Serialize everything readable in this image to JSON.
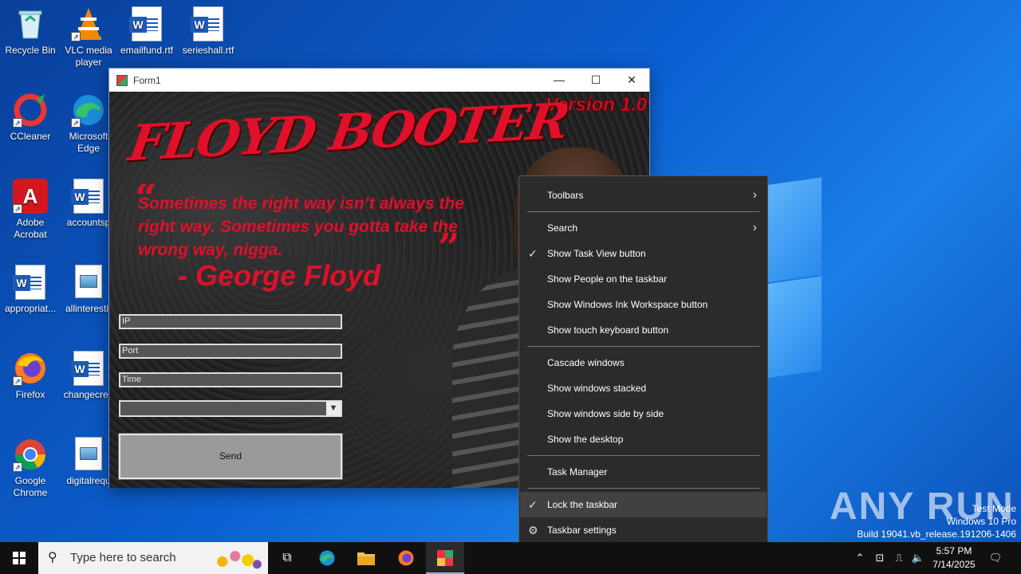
{
  "desktop": {
    "icons": [
      {
        "label": "Recycle Bin",
        "icon": "recycle-bin-icon"
      },
      {
        "label": "VLC media player",
        "icon": "vlc-icon"
      },
      {
        "label": "emailfund.rtf",
        "icon": "word-doc-icon"
      },
      {
        "label": "serieshall.rtf",
        "icon": "word-doc-icon"
      },
      {
        "label": "CCleaner",
        "icon": "ccleaner-icon"
      },
      {
        "label": "Microsoft Edge",
        "icon": "edge-icon"
      },
      {
        "label": "Adobe Acrobat",
        "icon": "acrobat-icon"
      },
      {
        "label": "accountsp",
        "icon": "word-doc-icon"
      },
      {
        "label": "appropriat...",
        "icon": "word-doc-icon"
      },
      {
        "label": "allinterestir",
        "icon": "image-doc-icon"
      },
      {
        "label": "Firefox",
        "icon": "firefox-icon"
      },
      {
        "label": "changecrea",
        "icon": "word-doc-icon"
      },
      {
        "label": "Google Chrome",
        "icon": "chrome-icon"
      },
      {
        "label": "digitalrequ",
        "icon": "image-doc-icon"
      }
    ]
  },
  "form": {
    "title": "Form1",
    "minimize": "—",
    "maximize": "☐",
    "close": "✕",
    "version": "Version 1.0",
    "logo": "FLOYD BOOTER",
    "quote_open": "“",
    "quote_close": "”",
    "quote": "Sometimes the right way isn’t always the right way. Sometimes you gotta take the wrong way, nigga.",
    "author": "- George Floyd",
    "ip_placeholder": "IP",
    "port_placeholder": "Port",
    "time_placeholder": "Time",
    "dropdown_value": "",
    "send_label": "Send"
  },
  "context_menu": {
    "items": [
      {
        "label": "Toolbars",
        "submenu": true
      },
      {
        "label": "Search",
        "submenu": true
      },
      {
        "label": "Show Task View button",
        "checked": true
      },
      {
        "label": "Show People on the taskbar"
      },
      {
        "label": "Show Windows Ink Workspace button"
      },
      {
        "label": "Show touch keyboard button"
      },
      {
        "label": "Cascade windows"
      },
      {
        "label": "Show windows stacked"
      },
      {
        "label": "Show windows side by side"
      },
      {
        "label": "Show the desktop"
      },
      {
        "label": "Task Manager"
      },
      {
        "label": "Lock the taskbar",
        "checked": true,
        "highlighted": true
      },
      {
        "label": "Taskbar settings",
        "icon": "gear-icon"
      }
    ]
  },
  "taskbar": {
    "search_placeholder": "Type here to search",
    "time": "5:57 PM",
    "date": "7/14/2025"
  },
  "watermark": {
    "brand": "ANY RUN",
    "mode": "Test Mode",
    "edition": "Windows 10 Pro",
    "build": "Build 19041.vb_release.191206-1406"
  },
  "colors": {
    "accent_red": "#e0102a",
    "menu_bg": "#2b2b2b",
    "taskbar_bg": "#101010"
  }
}
